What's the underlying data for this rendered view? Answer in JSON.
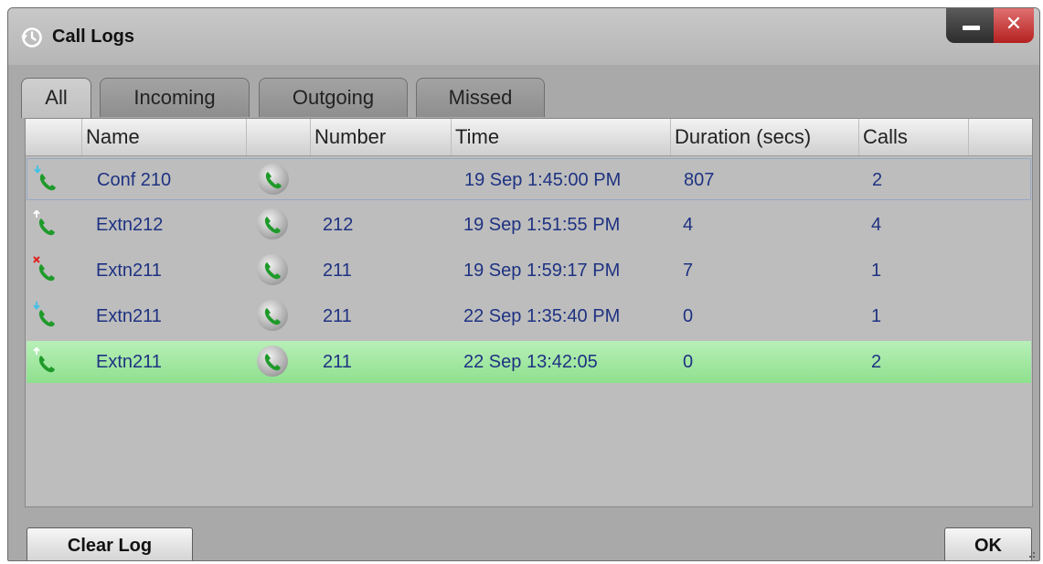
{
  "window": {
    "title": "Call Logs",
    "title_icon": "history-icon"
  },
  "controls": {
    "minimize_icon": "minimize-icon",
    "close_icon": "close-icon",
    "close_glyph": "✕"
  },
  "tabs": [
    {
      "label": "All",
      "active": true
    },
    {
      "label": "Incoming",
      "active": false
    },
    {
      "label": "Outgoing",
      "active": false
    },
    {
      "label": "Missed",
      "active": false
    }
  ],
  "columns": {
    "name": "Name",
    "number": "Number",
    "time": "Time",
    "duration": "Duration (secs)",
    "calls": "Calls"
  },
  "rows": [
    {
      "type": "incoming",
      "name": "Conf 210",
      "number": "",
      "time": "19 Sep 1:45:00 PM",
      "duration": "807",
      "calls": "2"
    },
    {
      "type": "outgoing",
      "name": "Extn212",
      "number": "212",
      "time": "19 Sep 1:51:55 PM",
      "duration": "4",
      "calls": "4"
    },
    {
      "type": "missed",
      "name": "Extn211",
      "number": "211",
      "time": "19 Sep 1:59:17 PM",
      "duration": "7",
      "calls": "1"
    },
    {
      "type": "incoming",
      "name": "Extn211",
      "number": "211",
      "time": "22 Sep 1:35:40 PM",
      "duration": "0",
      "calls": "1"
    },
    {
      "type": "outgoing",
      "name": "Extn211",
      "number": "211",
      "time": "22 Sep 13:42:05",
      "duration": "0",
      "calls": "2"
    }
  ],
  "footer": {
    "clear_label": "Clear Log",
    "ok_label": "OK"
  },
  "colors": {
    "row_text": "#1e3282",
    "selected_row": "#a6e8a6",
    "incoming_arrow": "#3ec0e8",
    "outgoing_arrow": "#ffffff",
    "missed_mark": "#e02020",
    "phone_green": "#1f9a2a"
  }
}
